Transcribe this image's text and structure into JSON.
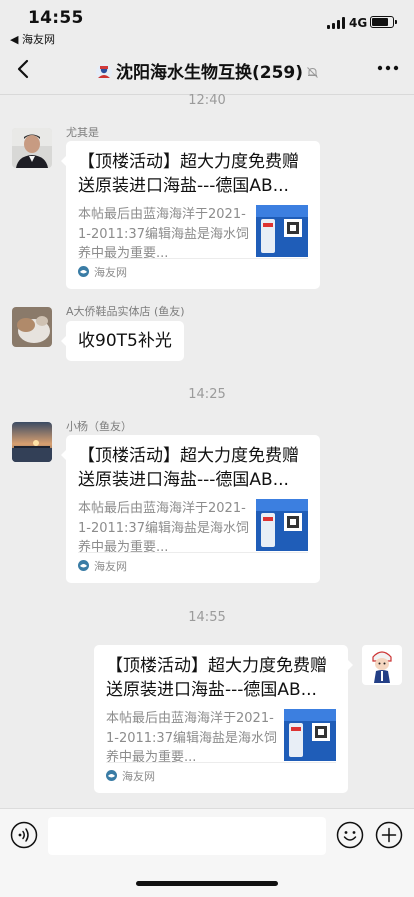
{
  "status_bar": {
    "time": "14:55",
    "back_app": "◀ 海友网",
    "network": "4G"
  },
  "nav": {
    "title": "沈阳海水生物互换(259)",
    "icons": [
      "back-chevron-icon",
      "group-avatar-icon",
      "mute-bell-icon",
      "more-dots-icon"
    ]
  },
  "messages": {
    "ts1": "12:40",
    "m1": {
      "sender": "尤其是",
      "title": "【顶楼活动】超大力度免费赠送原装进口海盐---德国AB...",
      "desc": "本帖最后由蓝海海洋于2021-1-2011:37编辑海盐是海水饲养中最为重要...",
      "source": "海友网"
    },
    "m2": {
      "sender": "A大侨鞋品实体店 (鱼友)",
      "text": "收90T5补光"
    },
    "ts2": "14:25",
    "m3": {
      "sender": "小杨（鱼友）",
      "title": "【顶楼活动】超大力度免费赠送原装进口海盐---德国AB...",
      "desc": "本帖最后由蓝海海洋于2021-1-2011:37编辑海盐是海水饲养中最为重要...",
      "source": "海友网"
    },
    "ts3": "14:55",
    "m4": {
      "title": "【顶楼活动】超大力度免费赠送原装进口海盐---德国AB...",
      "desc": "本帖最后由蓝海海洋于2021-1-2011:37编辑海盐是海水饲养中最为重要...",
      "source": "海友网"
    }
  },
  "input_bar": {
    "icons": [
      "voice-icon",
      "emoji-icon",
      "plus-icon"
    ]
  }
}
